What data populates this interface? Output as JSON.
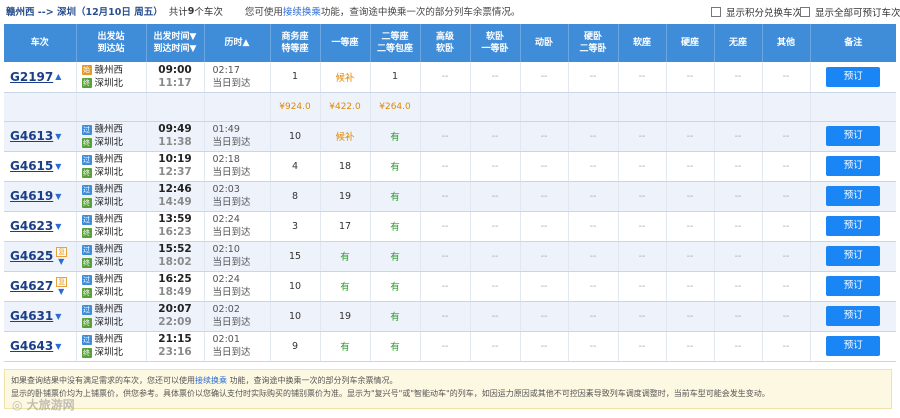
{
  "topbar": {
    "route": "赣州西 --> 深圳（12月10日 周五）",
    "count_prefix": "共计",
    "count": "9",
    "count_suffix": "个车次",
    "hint_pre": "您可使用",
    "hint_link": "接续换乘",
    "hint_post": "功能，查询途中换乘一次的部分列车余票情况。",
    "opt_points": "显示积分兑换车次",
    "opt_all": "显示全部可预订车次"
  },
  "headers": [
    "车次",
    "出发站\n到达站",
    "出发时间▼\n到达时间▼",
    "历时▲",
    "商务座\n特等座",
    "一等座",
    "二等座\n二等包座",
    "高级\n软卧",
    "软卧\n一等卧",
    "动卧",
    "硬卧\n二等卧",
    "软座",
    "硬座",
    "无座",
    "其他",
    "备注"
  ],
  "trains": [
    {
      "no": "G2197",
      "from": "赣州西",
      "to": "深圳北",
      "from_icon": "始",
      "to_icon": "终",
      "dep": "09:00",
      "arr": "11:17",
      "dur": "02:17",
      "day": "当日到达",
      "sw": "1",
      "first": "候补",
      "second": "1",
      "fu": "",
      "expanded": true
    },
    {
      "no": "G4613",
      "from": "赣州西",
      "to": "深圳北",
      "from_icon": "过",
      "to_icon": "终",
      "dep": "09:49",
      "arr": "11:38",
      "dur": "01:49",
      "day": "当日到达",
      "sw": "10",
      "first": "候补",
      "second": "有",
      "fu": ""
    },
    {
      "no": "G4615",
      "from": "赣州西",
      "to": "深圳北",
      "from_icon": "过",
      "to_icon": "终",
      "dep": "10:19",
      "arr": "12:37",
      "dur": "02:18",
      "day": "当日到达",
      "sw": "4",
      "first": "18",
      "second": "有",
      "fu": ""
    },
    {
      "no": "G4619",
      "from": "赣州西",
      "to": "深圳北",
      "from_icon": "过",
      "to_icon": "终",
      "dep": "12:46",
      "arr": "14:49",
      "dur": "02:03",
      "day": "当日到达",
      "sw": "8",
      "first": "19",
      "second": "有",
      "fu": ""
    },
    {
      "no": "G4623",
      "from": "赣州西",
      "to": "深圳北",
      "from_icon": "过",
      "to_icon": "终",
      "dep": "13:59",
      "arr": "16:23",
      "dur": "02:24",
      "day": "当日到达",
      "sw": "3",
      "first": "17",
      "second": "有",
      "fu": ""
    },
    {
      "no": "G4625",
      "from": "赣州西",
      "to": "深圳北",
      "from_icon": "过",
      "to_icon": "终",
      "dep": "15:52",
      "arr": "18:02",
      "dur": "02:10",
      "day": "当日到达",
      "sw": "15",
      "first": "有",
      "second": "有",
      "fu": "复"
    },
    {
      "no": "G4627",
      "from": "赣州西",
      "to": "深圳北",
      "from_icon": "过",
      "to_icon": "终",
      "dep": "16:25",
      "arr": "18:49",
      "dur": "02:24",
      "day": "当日到达",
      "sw": "10",
      "first": "有",
      "second": "有",
      "fu": "复"
    },
    {
      "no": "G4631",
      "from": "赣州西",
      "to": "深圳北",
      "from_icon": "过",
      "to_icon": "终",
      "dep": "20:07",
      "arr": "22:09",
      "dur": "02:02",
      "day": "当日到达",
      "sw": "10",
      "first": "19",
      "second": "有",
      "fu": ""
    },
    {
      "no": "G4643",
      "from": "赣州西",
      "to": "深圳北",
      "from_icon": "过",
      "to_icon": "终",
      "dep": "21:15",
      "arr": "23:16",
      "dur": "02:01",
      "day": "当日到达",
      "sw": "9",
      "first": "有",
      "second": "有",
      "fu": ""
    }
  ],
  "prices": {
    "sw": "¥924.0",
    "first": "¥422.0",
    "second": "¥264.0"
  },
  "dash": "--",
  "book": "预订",
  "footer": {
    "line1_pre": "如果查询结果中没有满足需求的车次，您还可以使用",
    "line1_link": "接续换乘",
    "line1_post": " 功能，查询途中换乘一次的部分列车余票情况。",
    "line2": "显示的卧铺票价均为上铺票价，供您参考。具体票价以您确认支付时实际购买的铺别票价为准。显示为\"复兴号\"或\"智能动车\"的列车，如因运力原因或其他不可控因素导致列车调度调整时，当前车型可能会发生变动。"
  },
  "watermark": "◎ 大旅游网",
  "colors": {
    "header": "#3f8cd9",
    "button": "#1a85f4",
    "available": "#2e9a2e",
    "waitlist": "#e08a00"
  }
}
